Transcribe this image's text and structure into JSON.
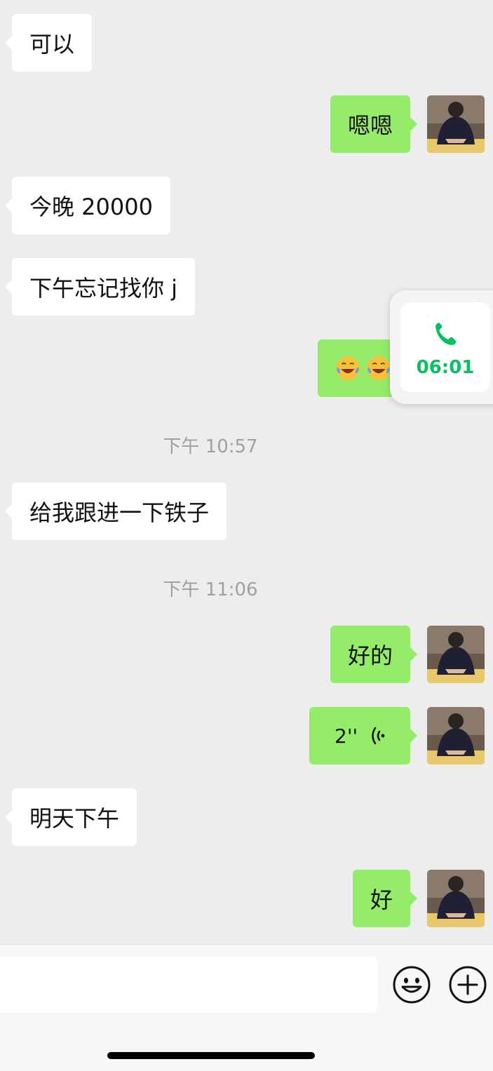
{
  "messages": {
    "m1": "可以",
    "m2": "嗯嗯",
    "m3": "今晚 20000",
    "m4": "下午忘记找你 j",
    "m6": "给我跟进一下铁子",
    "m7": "好的",
    "m9": "明天下午",
    "m10": "好"
  },
  "voice": {
    "duration": "2''"
  },
  "timestamps": {
    "t1": "下午 10:57",
    "t2": "下午 11:06"
  },
  "call_float": {
    "duration": "06:01"
  },
  "icons": {
    "emoji": "crying-laughing-emoji",
    "call": "phone-icon",
    "voice": "voice-wave-icon"
  },
  "colors": {
    "accent_green": "#07c160",
    "bubble_out": "#95ec69",
    "bubble_in": "#ffffff",
    "background": "#ededed"
  }
}
